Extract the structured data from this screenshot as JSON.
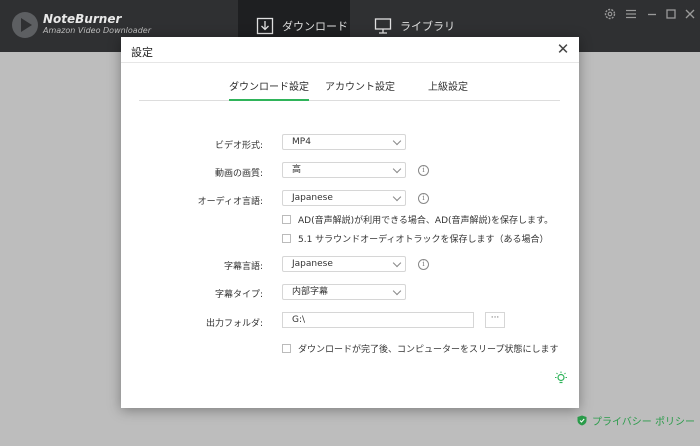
{
  "app": {
    "brand_name": "NoteBurner",
    "brand_sub": "Amazon Video Downloader",
    "nav": [
      {
        "label": "ダウンロード"
      },
      {
        "label": "ライブラリ"
      }
    ]
  },
  "dialog": {
    "title": "設定",
    "close": "✕",
    "tabs": [
      {
        "label": "ダウンロード設定"
      },
      {
        "label": "アカウント設定"
      },
      {
        "label": "上級設定"
      }
    ],
    "fields": {
      "video_format": {
        "label": "ビデオ形式:",
        "value": "MP4"
      },
      "video_quality": {
        "label": "動画の画質:",
        "value": "高"
      },
      "audio_language": {
        "label": "オーディオ言語:",
        "value": "Japanese"
      },
      "subtitle_language": {
        "label": "字幕言語:",
        "value": "Japanese"
      },
      "subtitle_type": {
        "label": "字幕タイプ:",
        "value": "内部字幕"
      },
      "output_folder": {
        "label": "出力フォルダ:",
        "value": "G:\\",
        "browse": "···"
      }
    },
    "checks": {
      "ad": "AD(音声解説)が利用できる場合、AD(音声解説)を保存します。",
      "surround": "5.1 サラウンドオーディオトラックを保存します（ある場合）",
      "sleep": "ダウンロードが完了後、コンピューターをスリープ状態にします"
    },
    "info_glyph": "i"
  },
  "footer": {
    "privacy": "プライバシー ポリシー"
  },
  "colors": {
    "accent": "#2fb45a",
    "titlebar": "#2f3032",
    "privacy_link": "#2a9b4a"
  }
}
